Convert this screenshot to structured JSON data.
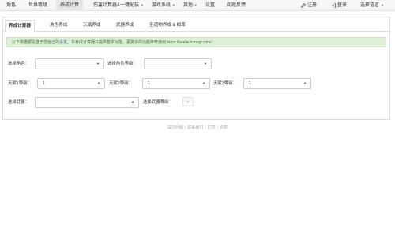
{
  "nav": {
    "items": [
      "角色",
      "世界等级",
      "养成计算",
      "伤害计算器&一键配装",
      "游戏系统",
      "其他",
      "设置",
      "问题反馈"
    ],
    "register": "注册",
    "login": "登录",
    "language": "选择语言"
  },
  "tabs": [
    "养成计算器",
    "角色养成",
    "天赋养成",
    "武器养成",
    "圣遗物养成 & 概率"
  ],
  "notice": {
    "before": "以下数据都是基于您自己的",
    "link": "设定",
    "after": "。本养成计算器只提供基本功能，更复杂的功能推荐使用 https://seelie.inmagi.com/"
  },
  "form": {
    "character_label": "选择角色：",
    "character_value": "",
    "char_level_label": "选择角色等级：",
    "char_level_value": "",
    "talent1_label": "天赋1等级：",
    "talent1_value": "1",
    "talent2_label": "天赋2等级：",
    "talent2_value": "1",
    "talent3_label": "天赋3等级：",
    "talent3_value": "1",
    "weapon_label": "选择武器：",
    "weapon_value": "",
    "weapon_level_label": "选择武器等级：",
    "weapon_level_value": ""
  },
  "footer": [
    "提交问题",
    "联系我们",
    "打赏",
    "词表"
  ]
}
